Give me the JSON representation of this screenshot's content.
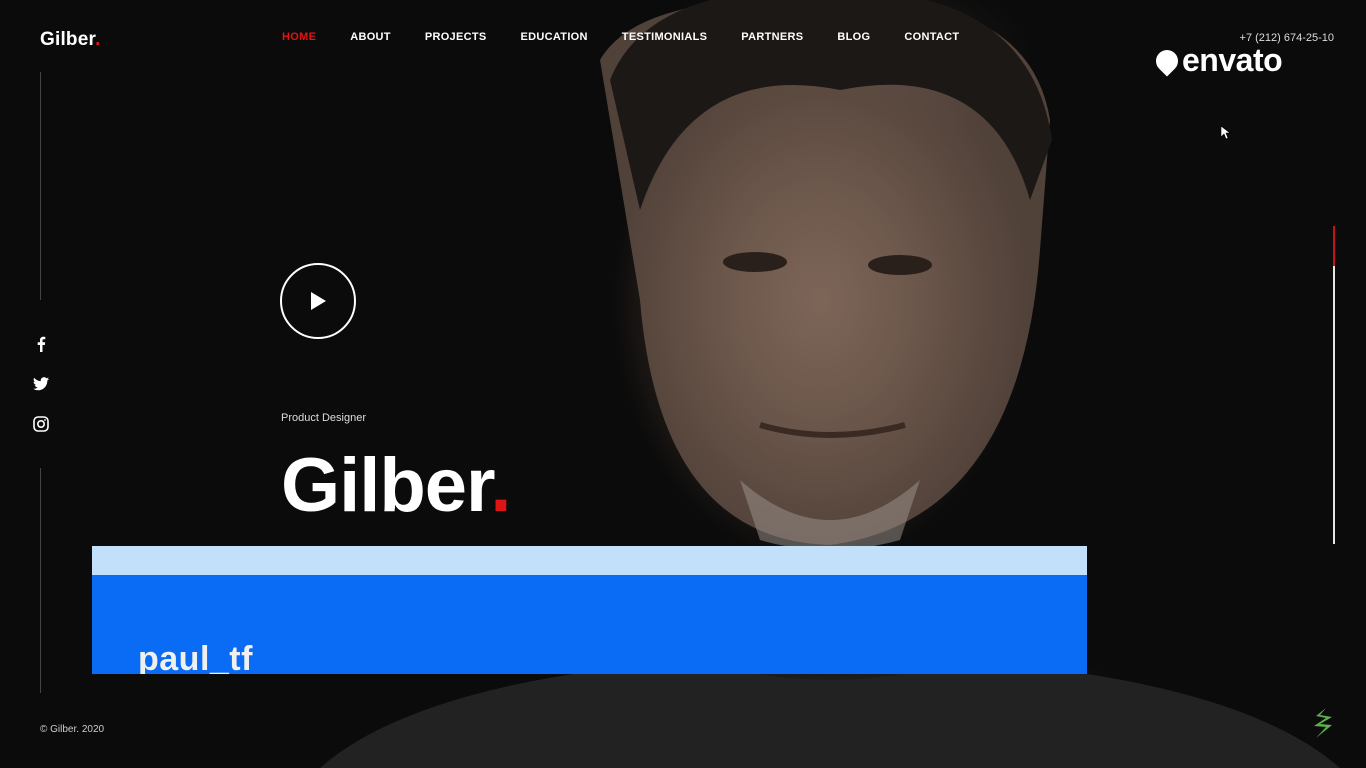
{
  "brand": {
    "name": "Gilber",
    "dot": "."
  },
  "nav": {
    "items": [
      {
        "label": "HOME",
        "active": true
      },
      {
        "label": "ABOUT",
        "active": false
      },
      {
        "label": "PROJECTS",
        "active": false
      },
      {
        "label": "EDUCATION",
        "active": false
      },
      {
        "label": "TESTIMONIALS",
        "active": false
      },
      {
        "label": "PARTNERS",
        "active": false
      },
      {
        "label": "BLOG",
        "active": false
      },
      {
        "label": "CONTACT",
        "active": false
      }
    ]
  },
  "header": {
    "phone": "+7 (212) 674-25-10"
  },
  "watermark": {
    "text": "envato"
  },
  "social": [
    {
      "icon": "facebook-icon"
    },
    {
      "icon": "twitter-icon"
    },
    {
      "icon": "instagram-icon"
    }
  ],
  "hero": {
    "subtitle": "Product Designer",
    "title": "Gilber",
    "title_dot": "."
  },
  "banner": {
    "author": "paul_tf"
  },
  "footer": {
    "copyright": "© Gilber. 2020"
  },
  "colors": {
    "accent": "#e11414",
    "banner": "#0a6cf5",
    "banner_strip": "#c3e0fb",
    "background": "#0b0b0b"
  }
}
